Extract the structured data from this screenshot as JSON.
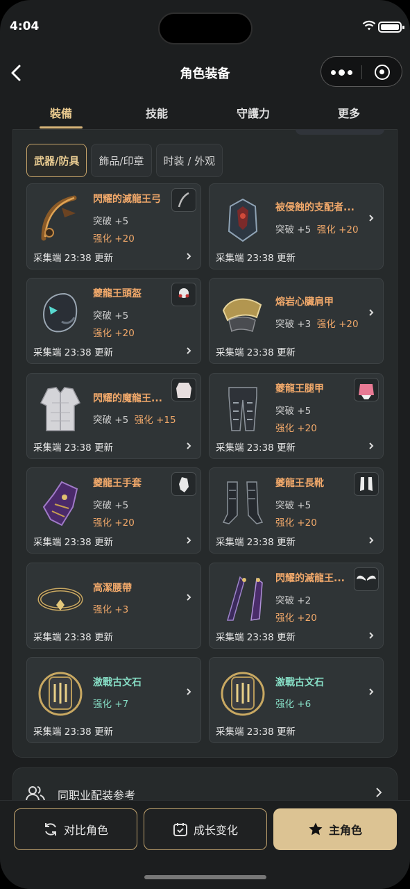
{
  "status": {
    "time": "4:04"
  },
  "nav": {
    "title": "角色装备"
  },
  "tabs": [
    "裝備",
    "技能",
    "守護力",
    "更多"
  ],
  "subtabs": [
    "武器/防具",
    "飾品/印章",
    "时装 / 外观"
  ],
  "items": [
    {
      "name": "閃耀的滅龍王弓",
      "line1": "突破 +5",
      "line2": "强化 +20",
      "update": "采集端 23:38 更新"
    },
    {
      "name": "被侵蝕的支配者...",
      "line1": "突破 +5",
      "line1b": "强化 +20",
      "update": "采集端 23:38 更新"
    },
    {
      "name": "夔龍王頭盔",
      "line1": "突破 +5",
      "line2": "强化 +20",
      "update": "采集端 23:38 更新"
    },
    {
      "name": "熔岩心臟肩甲",
      "line1": "突破 +3",
      "line1b": "强化 +20",
      "update": "采集端 23:38 更新"
    },
    {
      "name": "閃耀的魔龍王...",
      "line1": "突破 +5",
      "line1b": "强化 +15",
      "update": "采集端 23:38 更新"
    },
    {
      "name": "夔龍王腿甲",
      "line1": "突破 +5",
      "line2": "强化 +20",
      "update": "采集端 23:38 更新"
    },
    {
      "name": "夔龍王手套",
      "line1": "突破 +5",
      "line2": "强化 +20",
      "update": "采集端 23:38 更新"
    },
    {
      "name": "夔龍王長靴",
      "line1": "突破 +5",
      "line2": "强化 +20",
      "update": "采集端 23:38 更新"
    },
    {
      "name": "高潔腰帶",
      "line1": "强化 +3",
      "update": "采集端 23:38 更新"
    },
    {
      "name": "閃耀的滅龍王...",
      "line1": "突破 +2",
      "line2": "强化 +20",
      "update": "采集端 23:38 更新"
    },
    {
      "name": "激戰古文石",
      "line1": "强化 +7",
      "update": "采集端 23:38 更新"
    },
    {
      "name": "激戰古文石",
      "line1": "强化 +6",
      "update": "采集端 23:38 更新"
    }
  ],
  "reference": {
    "label": "同职业配装参考"
  },
  "actions": {
    "compare": "对比角色",
    "growth": "成长变化",
    "main": "主角色"
  },
  "colors": {
    "accent": "#d8b67a",
    "item_name": "#f0a86a",
    "rune_name": "#86dcc4",
    "panel": "#262a2b"
  }
}
